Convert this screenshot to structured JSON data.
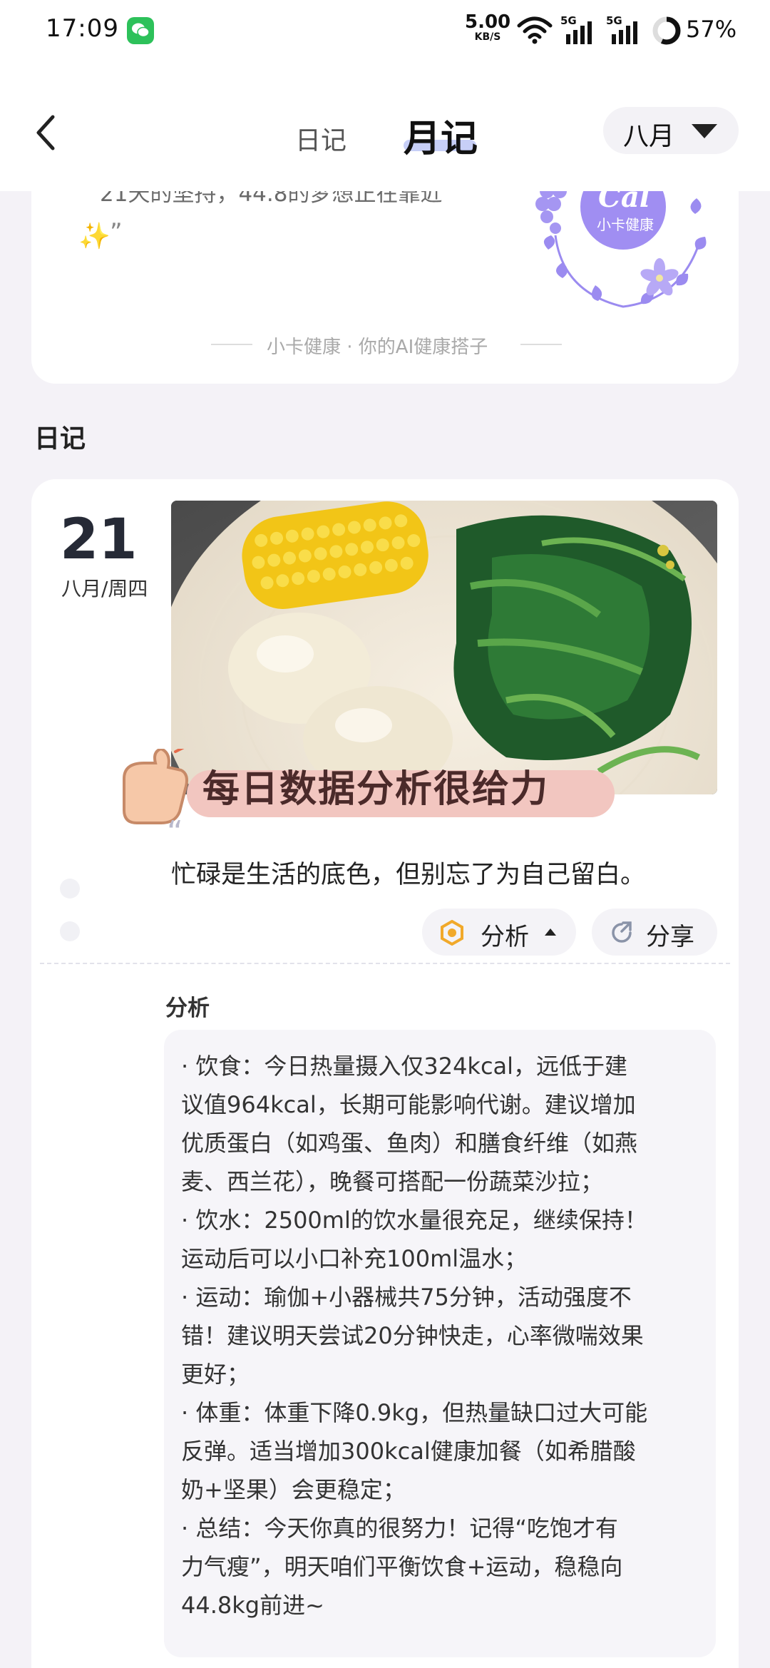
{
  "status_bar": {
    "time": "17:09",
    "net_speed_value": "5.00",
    "net_speed_unit": "KB/S",
    "signal_1_label": "5G",
    "signal_2_label": "5G",
    "battery": "57%"
  },
  "header": {
    "tabs": [
      {
        "label": "日记",
        "active": false
      },
      {
        "label": "月记",
        "active": true
      }
    ],
    "month_select": "八月"
  },
  "top_card": {
    "partial_text": "21天的坚持，44.8的梦想正在靠近",
    "sparkle_emoji": "✨",
    "closing_quote": "”",
    "logo_text": "Cal",
    "logo_subtext": "小卡健康",
    "footer": "小卡健康 · 你的AI健康搭子"
  },
  "section_title": "日记",
  "diary_entry": {
    "day": "21",
    "sub": "八月/周四",
    "sticker_text": "每日数据分析很给力",
    "open_quote": "“",
    "quote": "忙碌是生活的底色，但别忘了为自己留白。",
    "analyze_button": "分析",
    "share_button": "分享",
    "analysis_title": "分析",
    "analysis_lines": [
      "· 饮食：今日热量摄入仅324kcal，远低于建",
      "议值964kcal，长期可能影响代谢。建议增加",
      "优质蛋白（如鸡蛋、鱼肉）和膳食纤维（如燕",
      "麦、西兰花），晚餐可搭配一份蔬菜沙拉；",
      "· 饮水：2500ml的饮水量很充足，继续保持！",
      "运动后可以小口补充100ml温水；",
      "· 运动：瑜伽+小器械共75分钟，活动强度不",
      "错！建议明天尝试20分钟快走，心率微喘效果",
      "更好；",
      "· 体重：体重下降0.9kg，但热量缺口过大可能",
      "反弹。适当增加300kcal健康加餐（如希腊酸",
      "奶+坚果）会更稳定；",
      "· 总结：今天你真的很努力！记得“吃饱才有",
      "力气瘦”，明天咱们平衡饮食+运动，稳稳向",
      "44.8kg前进~"
    ]
  },
  "colors": {
    "accent_purple": "#9b8bf0",
    "tab_underline": "#c7cff7",
    "page_bg": "#f4f2f7",
    "wechat_green": "#2dc15a"
  },
  "icons": [
    "back-arrow-icon",
    "chevron-down-icon",
    "wifi-icon",
    "signal-icon",
    "battery-ring-icon",
    "wechat-icon",
    "analysis-icon",
    "share-icon",
    "caret-up-icon",
    "thumbs-up-icon"
  ]
}
